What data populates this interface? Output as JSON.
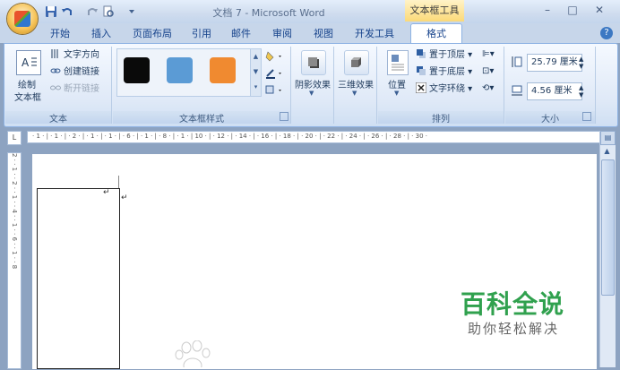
{
  "window": {
    "title": "文档 7 - Microsoft Word",
    "context_tab_header": "文本框工具",
    "controls": {
      "minimize": "–",
      "maximize": "□",
      "close": "✕"
    }
  },
  "quick_access": {
    "icons": [
      "save-icon",
      "undo-icon",
      "redo-icon",
      "print-preview-icon",
      "customize-icon"
    ]
  },
  "tabs": [
    {
      "label": "开始"
    },
    {
      "label": "插入"
    },
    {
      "label": "页面布局"
    },
    {
      "label": "引用"
    },
    {
      "label": "邮件"
    },
    {
      "label": "审阅"
    },
    {
      "label": "视图"
    },
    {
      "label": "开发工具"
    },
    {
      "label": "格式",
      "active": true
    }
  ],
  "ribbon": {
    "text_group": {
      "label": "文本",
      "draw_textbox_line1": "绘制",
      "draw_textbox_line2": "文本框",
      "text_direction": "文字方向",
      "create_link": "创建链接",
      "break_link": "断开链接"
    },
    "styles_group": {
      "label": "文本框样式",
      "swatches": [
        "#0a0a0a",
        "#5b9bd5",
        "#f08a30"
      ]
    },
    "shadow_group": {
      "label": "阴影效果"
    },
    "threed_group": {
      "label": "三维效果"
    },
    "arrange_group": {
      "label": "排列",
      "position": "位置",
      "bring_front": "置于顶层",
      "send_back": "置于底层",
      "text_wrap": "文字环绕"
    },
    "size_group": {
      "label": "大小",
      "height": "25.79 厘米",
      "width": "4.56 厘米"
    }
  },
  "ruler": {
    "horizontal": "· 1 · | · 1 · | · 2 · | · 1 · | · 1 · | · 6 · | · 1 · | · 8 · | · 1 · | 10 · | · 12 · | · 14 · | · 16 · | · 18 · | · 20 · | · 22 · | · 24 · | · 26 · | · 28 · | · 30 ·",
    "vertical": "2 · · 1 · · 2 · · 1 · · 4 · · 1 · · 6 · · 1 · · 8"
  },
  "document": {
    "textbox_marker": "↵",
    "paragraph_mark": "↵"
  },
  "watermark": {
    "title": "百科全说",
    "subtitle": "助你轻松解决"
  }
}
